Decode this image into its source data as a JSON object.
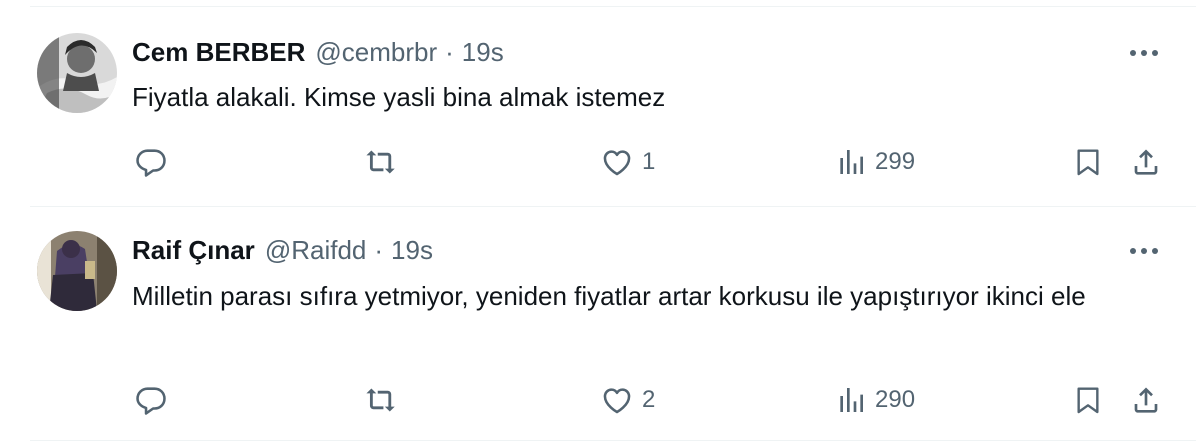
{
  "tweets": [
    {
      "name": "Cem BERBER",
      "handle": "@cembrbr",
      "separator": "·",
      "time": "19s",
      "text": "Fiyatla alakali. Kimse yasli bina almak istemez",
      "more_icon": "more-dots-icon",
      "stats": {
        "replies": "",
        "retweets": "",
        "likes": "1",
        "views": "299"
      },
      "avatar_colors": [
        "#2b2b2b",
        "#9a9a9a",
        "#e6e6e6"
      ]
    },
    {
      "name": "Raif Çınar",
      "handle": "@Raifdd",
      "separator": "·",
      "time": "19s",
      "text": "Milletin parası sıfıra yetmiyor, yeniden fiyatlar artar korkusu ile yapıştırıyor ikinci ele",
      "more_icon": "more-dots-icon",
      "stats": {
        "replies": "",
        "retweets": "",
        "likes": "2",
        "views": "290"
      },
      "avatar_colors": [
        "#4a3f63",
        "#8a7fa8",
        "#c9b98a"
      ]
    }
  ],
  "colors": {
    "text": "#0f1419",
    "muted": "#536471",
    "divider": "#eff3f4"
  },
  "icons": [
    "reply-icon",
    "retweet-icon",
    "like-icon",
    "views-icon",
    "bookmark-icon",
    "share-icon",
    "more-dots-icon"
  ]
}
